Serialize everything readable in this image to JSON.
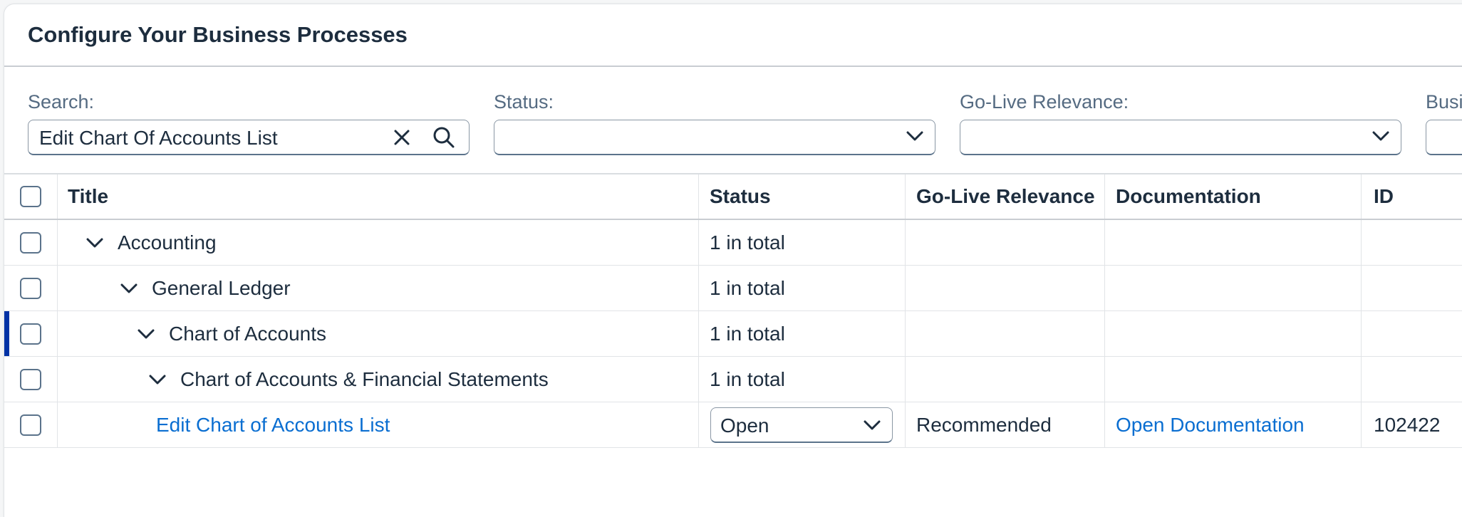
{
  "page": {
    "title": "Configure Your Business Processes"
  },
  "filters": {
    "search": {
      "label": "Search:",
      "value": "Edit Chart Of Accounts List"
    },
    "status": {
      "label": "Status:",
      "value": ""
    },
    "golive": {
      "label": "Go-Live Relevance:",
      "value": ""
    },
    "business": {
      "label": "Busi"
    }
  },
  "table": {
    "columns": [
      "Title",
      "Status",
      "Go-Live Relevance",
      "Documentation",
      "ID"
    ],
    "rows": [
      {
        "title": "Accounting",
        "status": "1 in total",
        "golive": "",
        "documentation": "",
        "id": ""
      },
      {
        "title": "General Ledger",
        "status": "1 in total",
        "golive": "",
        "documentation": "",
        "id": ""
      },
      {
        "title": "Chart of Accounts",
        "status": "1 in total",
        "golive": "",
        "documentation": "",
        "id": ""
      },
      {
        "title": "Chart of Accounts & Financial Statements",
        "status": "1 in total",
        "golive": "",
        "documentation": "",
        "id": ""
      },
      {
        "title": "Edit Chart of Accounts List",
        "status": "Open",
        "golive": "Recommended",
        "documentation": "Open Documentation",
        "id": "102422"
      }
    ]
  },
  "colors": {
    "accent": "#0a6ed1",
    "selection": "#0032a5",
    "text": "#1d2d3e",
    "label": "#556b82"
  }
}
